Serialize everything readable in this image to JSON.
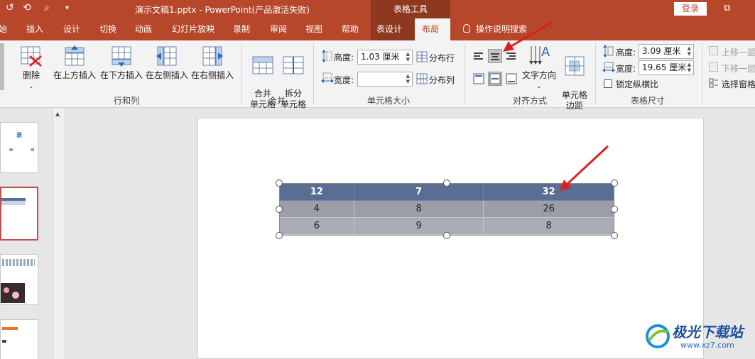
{
  "titlebar": {
    "title": "演示文稿1.pptx  -  PowerPoint(产品激活失败)",
    "context_group": "表格工具",
    "login": "登录"
  },
  "tabs": [
    {
      "label": "始"
    },
    {
      "label": "插入"
    },
    {
      "label": "设计"
    },
    {
      "label": "切换"
    },
    {
      "label": "动画"
    },
    {
      "label": "幻灯片放映"
    },
    {
      "label": "录制"
    },
    {
      "label": "审阅"
    },
    {
      "label": "视图"
    },
    {
      "label": "帮助"
    },
    {
      "label": "表设计"
    },
    {
      "label": "布局"
    },
    {
      "label": "操作说明搜索"
    }
  ],
  "ribbon": {
    "rows_cols": {
      "delete": "删除",
      "insert_above": "在上方插入",
      "insert_below": "在下方插入",
      "insert_left": "在左侧插入",
      "insert_right": "在右侧插入",
      "group_label": "行和列"
    },
    "merge": {
      "merge_cells": "合并\n单元格",
      "split_cells": "拆分\n单元格",
      "group_label": "合并"
    },
    "cell_size": {
      "height_label": "高度:",
      "height_value": "1.03 厘米",
      "width_label": "宽度:",
      "width_value": "",
      "distribute_rows": "分布行",
      "distribute_cols": "分布列",
      "group_label": "单元格大小"
    },
    "alignment": {
      "text_direction": "文字方向",
      "cell_margins": "单元格\n边距",
      "group_label": "对齐方式"
    },
    "table_size": {
      "height_label": "高度:",
      "height_value": "3.09 厘米",
      "width_label": "宽度:",
      "width_value": "19.65 厘米",
      "lock_ratio": "锁定纵横比",
      "group_label": "表格尺寸"
    },
    "arrange": {
      "bring_forward": "上移一层",
      "send_backward": "下移一层",
      "selection_pane": "选择窗格"
    }
  },
  "thumb1": {
    "title": "录"
  },
  "slide_table": {
    "rows": [
      [
        "12",
        "7",
        "32"
      ],
      [
        "4",
        "8",
        "26"
      ],
      [
        "6",
        "9",
        "8"
      ]
    ]
  },
  "watermark": {
    "name": "极光下载站",
    "url": "www.xz7.com"
  },
  "colors": {
    "accent": "#b7472a",
    "context_tab": "#8f3820",
    "header_row": "#5a6e94",
    "body_row": "#9b9ea6",
    "annotation_arrow": "#d9221c"
  }
}
